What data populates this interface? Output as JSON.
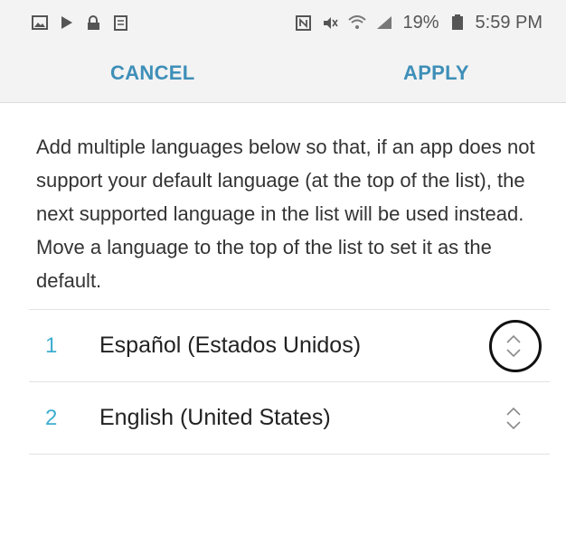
{
  "status_bar": {
    "left_icons": [
      "gallery-icon",
      "play-store-icon",
      "lock-icon",
      "document-icon"
    ],
    "right_icons": [
      "nfc-icon",
      "mute-icon",
      "wifi-icon",
      "signal-icon",
      "battery-icon"
    ],
    "battery_percent": "19%",
    "time": "5:59 PM"
  },
  "action_bar": {
    "cancel_label": "CANCEL",
    "apply_label": "APPLY"
  },
  "description": "Add multiple languages below so that, if an app does not support your default language (at the top of the list), the next supported language in the list will be used instead. Move a language to the top of the list to set it as the default.",
  "languages": [
    {
      "index": "1",
      "name": "Español (Estados Unidos)",
      "reorder_icon": "reorder-icon",
      "highlighted": true
    },
    {
      "index": "2",
      "name": "English (United States)",
      "reorder_icon": "reorder-icon",
      "highlighted": false
    }
  ],
  "colors": {
    "accent": "#3e8fb8",
    "index": "#3eaed0",
    "bar_background": "#f3f3f3"
  }
}
